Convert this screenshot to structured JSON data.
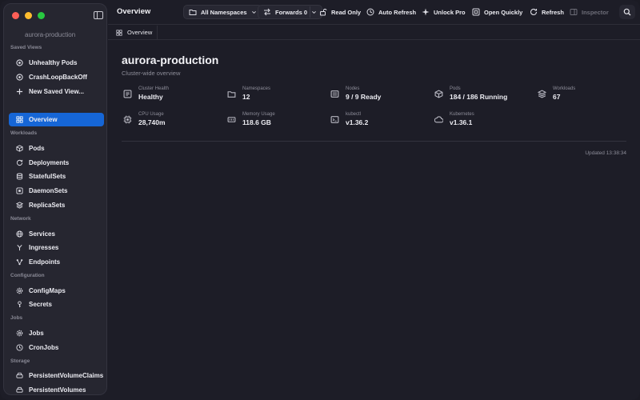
{
  "sidebar": {
    "cluster": "aurora-production",
    "saved_views_label": "Saved Views",
    "saved_views": [
      {
        "label": "Unhealthy Pods",
        "icon": "alert-circle-icon"
      },
      {
        "label": "CrashLoopBackOff",
        "icon": "alert-circle-icon"
      },
      {
        "label": "New Saved View...",
        "icon": "plus-icon"
      }
    ],
    "overview": {
      "label": "Overview",
      "icon": "grid-icon"
    },
    "sections": [
      {
        "label": "Workloads",
        "items": [
          {
            "label": "Pods",
            "icon": "cube-icon"
          },
          {
            "label": "Deployments",
            "icon": "refresh-icon"
          },
          {
            "label": "StatefulSets",
            "icon": "database-icon"
          },
          {
            "label": "DaemonSets",
            "icon": "daemon-icon"
          },
          {
            "label": "ReplicaSets",
            "icon": "layers-icon"
          }
        ]
      },
      {
        "label": "Network",
        "items": [
          {
            "label": "Services",
            "icon": "globe-icon"
          },
          {
            "label": "Ingresses",
            "icon": "fork-icon"
          },
          {
            "label": "Endpoints",
            "icon": "nodes-icon"
          }
        ]
      },
      {
        "label": "Configuration",
        "items": [
          {
            "label": "ConfigMaps",
            "icon": "gear-icon"
          },
          {
            "label": "Secrets",
            "icon": "key-icon"
          }
        ]
      },
      {
        "label": "Jobs",
        "items": [
          {
            "label": "Jobs",
            "icon": "gear-icon"
          },
          {
            "label": "CronJobs",
            "icon": "clock-icon"
          }
        ]
      },
      {
        "label": "Storage",
        "items": [
          {
            "label": "PersistentVolumeClaims",
            "icon": "drive-icon"
          },
          {
            "label": "PersistentVolumes",
            "icon": "drive-icon"
          }
        ]
      }
    ]
  },
  "toolbar": {
    "title": "Overview",
    "namespace": "All Namespaces",
    "forwards": "Forwards 0",
    "read_only": "Read Only",
    "auto_refresh": "Auto Refresh",
    "unlock_pro": "Unlock Pro",
    "open_quickly": "Open Quickly",
    "refresh": "Refresh",
    "inspector": "Inspector"
  },
  "tab": {
    "label": "Overview"
  },
  "main": {
    "title": "aurora-production",
    "subtitle": "Cluster-wide overview",
    "stats": [
      {
        "label": "Cluster Health",
        "value": "Healthy",
        "icon": "health-icon"
      },
      {
        "label": "Namespaces",
        "value": "12",
        "icon": "folder-icon"
      },
      {
        "label": "Nodes",
        "value": "9 / 9 Ready",
        "icon": "server-icon"
      },
      {
        "label": "Pods",
        "value": "184 / 186 Running",
        "icon": "cube-icon"
      },
      {
        "label": "Workloads",
        "value": "67",
        "icon": "layers-icon"
      },
      {
        "label": "CPU Usage",
        "value": "28,740m",
        "icon": "cpu-icon"
      },
      {
        "label": "Memory Usage",
        "value": "118.6 GB",
        "icon": "memory-icon"
      },
      {
        "label": "kubectl",
        "value": "v1.36.2",
        "icon": "terminal-icon"
      },
      {
        "label": "Kubernetes",
        "value": "v1.36.1",
        "icon": "cloud-icon"
      }
    ],
    "updated": "Updated 13:38:34"
  },
  "colors": {
    "accent": "#1666d6",
    "background": "#1d1d27",
    "sidebar": "#262630"
  }
}
